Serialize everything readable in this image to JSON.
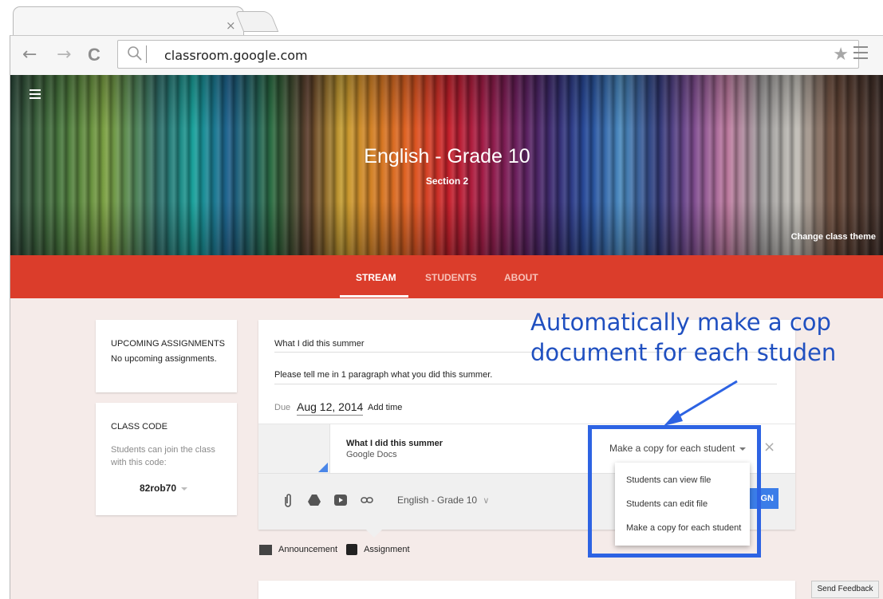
{
  "browser": {
    "tab_close": "×",
    "url": "classroom.google.com",
    "back": "←",
    "forward": "→",
    "reload": "C",
    "star": "★"
  },
  "banner": {
    "title": "English - Grade 10",
    "section": "Section 2",
    "change_theme": "Change class theme"
  },
  "tabs": [
    {
      "label": "STREAM",
      "active": true
    },
    {
      "label": "STUDENTS",
      "active": false
    },
    {
      "label": "ABOUT",
      "active": false
    }
  ],
  "sidebar": {
    "upcoming_heading": "UPCOMING ASSIGNMENTS",
    "upcoming_text": "No upcoming assignments.",
    "class_code_heading": "CLASS CODE",
    "class_code_desc_1": "Students can join the class",
    "class_code_desc_2": "with this code:",
    "class_code": "82rob70"
  },
  "assignment": {
    "title": "What I did this summer",
    "description": "Please tell me in 1 paragraph what you did this summer.",
    "due_label": "Due",
    "due_date": "Aug 12, 2014",
    "add_time": "Add time",
    "attachment_title": "What I did this summer",
    "attachment_type": "Google Docs",
    "share_option": "Make a copy for each student",
    "class_select": "English - Grade 10",
    "assign_button_fragment": "GN"
  },
  "share_menu": {
    "options": [
      "Students can view file",
      "Students can edit file",
      "Make a copy for each student"
    ]
  },
  "post_types": {
    "announcement": "Announcement",
    "assignment": "Assignment"
  },
  "callout": {
    "line1": "Automatically make a cop",
    "line2": "document for each studen"
  },
  "send_feedback": "Send Feedback",
  "colors": {
    "accent_red": "#db3d2b",
    "callout_blue": "#2d63e3",
    "assign_blue": "#3b7de8"
  }
}
